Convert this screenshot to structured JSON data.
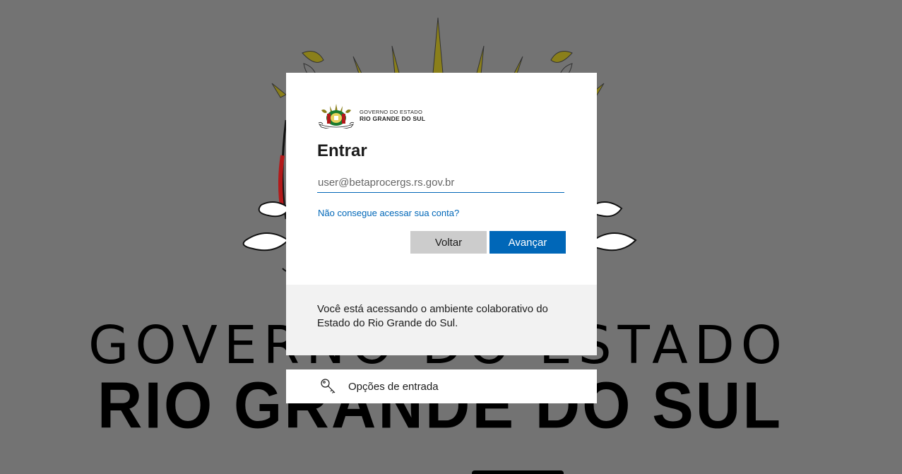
{
  "background": {
    "line1": "GOVERNO DO ESTADO",
    "line2": "RIO GRANDE DO SUL"
  },
  "logo": {
    "line1": "GOVERNO DO ESTADO",
    "line2": "RIO GRANDE DO SUL"
  },
  "signin": {
    "title": "Entrar",
    "email_placeholder": "user@betaprocergs.rs.gov.br",
    "email_value": "",
    "help_link": "Não consegue acessar sua conta?",
    "back_label": "Voltar",
    "next_label": "Avançar"
  },
  "info": {
    "text": "Você está acessando o ambiente colaborativo do Estado do Rio Grande do Sul."
  },
  "options": {
    "label": "Opções de entrada",
    "icon": "key-icon"
  },
  "colors": {
    "accent": "#0067b8",
    "background": "#737373",
    "panel": "#f2f2f2"
  }
}
